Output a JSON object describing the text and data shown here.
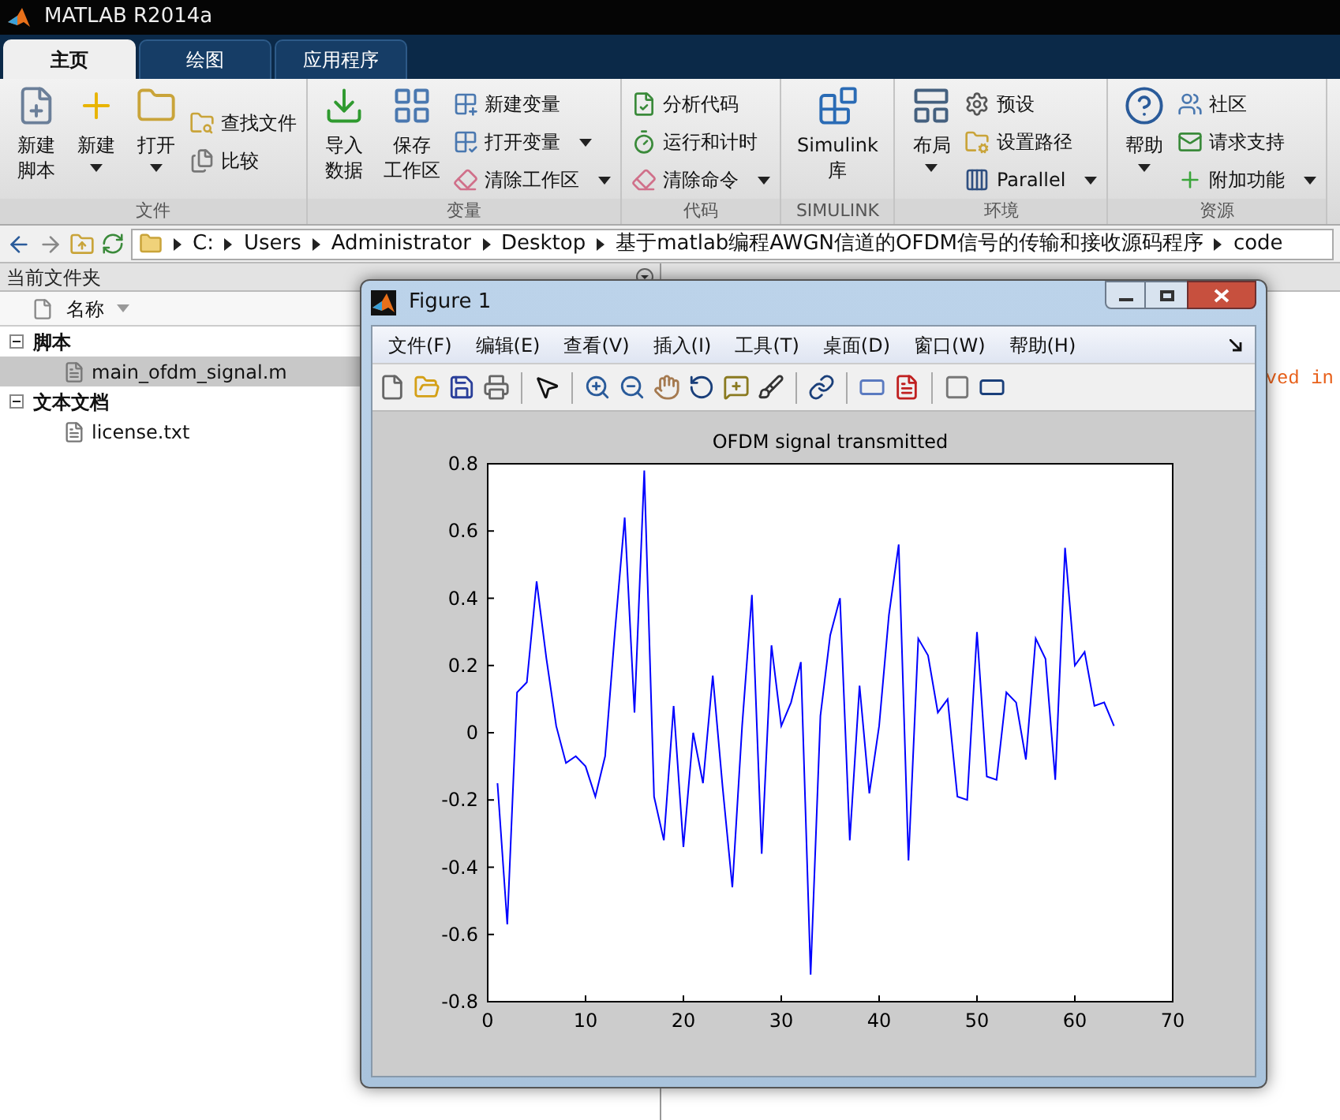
{
  "title_bar": {
    "title": "MATLAB R2014a"
  },
  "tabs": [
    {
      "label": "主页",
      "selected": true
    },
    {
      "label": "绘图",
      "selected": false
    },
    {
      "label": "应用程序",
      "selected": false
    }
  ],
  "ribbon": {
    "groups": [
      {
        "label": "文件",
        "items": [
          {
            "kind": "large",
            "lines": [
              "新建",
              "脚本"
            ],
            "dropdown": false
          },
          {
            "kind": "large",
            "lines": [
              "新建"
            ],
            "dropdown": true
          },
          {
            "kind": "large",
            "lines": [
              "打开"
            ],
            "dropdown": true
          },
          {
            "kind": "small",
            "lines": [
              "查找文件"
            ],
            "dropdown": false
          },
          {
            "kind": "small",
            "lines": [
              "比较"
            ],
            "dropdown": false
          }
        ]
      },
      {
        "label": "变量",
        "items": [
          {
            "kind": "large",
            "lines": [
              "导入",
              "数据"
            ],
            "dropdown": false
          },
          {
            "kind": "large",
            "lines": [
              "保存",
              "工作区"
            ],
            "dropdown": false
          },
          {
            "kind": "small",
            "lines": [
              "新建变量"
            ],
            "dropdown": false
          },
          {
            "kind": "small",
            "lines": [
              "打开变量"
            ],
            "dropdown": true
          },
          {
            "kind": "small",
            "lines": [
              "清除工作区"
            ],
            "dropdown": true
          }
        ]
      },
      {
        "label": "代码",
        "items": [
          {
            "kind": "small",
            "lines": [
              "分析代码"
            ],
            "dropdown": false
          },
          {
            "kind": "small",
            "lines": [
              "运行和计时"
            ],
            "dropdown": false
          },
          {
            "kind": "small",
            "lines": [
              "清除命令"
            ],
            "dropdown": true
          }
        ]
      },
      {
        "label": "SIMULINK",
        "items": [
          {
            "kind": "large",
            "lines": [
              "Simulink",
              "库"
            ],
            "dropdown": false
          }
        ]
      },
      {
        "label": "环境",
        "items": [
          {
            "kind": "large",
            "lines": [
              "布局"
            ],
            "dropdown": true
          },
          {
            "kind": "small",
            "lines": [
              "预设"
            ],
            "dropdown": false
          },
          {
            "kind": "small",
            "lines": [
              "设置路径"
            ],
            "dropdown": false
          },
          {
            "kind": "small",
            "lines": [
              "Parallel"
            ],
            "dropdown": true
          }
        ]
      },
      {
        "label": "资源",
        "items": [
          {
            "kind": "large",
            "lines": [
              "帮助"
            ],
            "dropdown": true
          },
          {
            "kind": "small",
            "lines": [
              "社区"
            ],
            "dropdown": false
          },
          {
            "kind": "small",
            "lines": [
              "请求支持"
            ],
            "dropdown": false
          },
          {
            "kind": "small",
            "lines": [
              "附加功能"
            ],
            "dropdown": true
          }
        ]
      }
    ]
  },
  "address_bar": {
    "segments": [
      "C:",
      "Users",
      "Administrator",
      "Desktop",
      "基于matlab编程AWGN信道的OFDM信号的传输和接收源码程序",
      "code"
    ]
  },
  "current_folder": {
    "title": "当前文件夹",
    "column": "名称",
    "tree": [
      {
        "label": "脚本",
        "expanded": true,
        "children": [
          {
            "label": "main_ofdm_signal.m",
            "selected": true
          }
        ]
      },
      {
        "label": "文本文档",
        "expanded": true,
        "children": [
          {
            "label": "license.txt",
            "selected": false
          }
        ]
      }
    ]
  },
  "command_window": {
    "text": "ved in"
  },
  "figure": {
    "title": "Figure 1",
    "menu": [
      "文件(F)",
      "编辑(E)",
      "查看(V)",
      "插入(I)",
      "工具(T)",
      "桌面(D)",
      "窗口(W)",
      "帮助(H)"
    ],
    "chart_data": {
      "type": "line",
      "title": "OFDM signal transmitted",
      "x": [
        1,
        2,
        3,
        4,
        5,
        6,
        7,
        8,
        9,
        10,
        11,
        12,
        13,
        14,
        15,
        16,
        17,
        18,
        19,
        20,
        21,
        22,
        23,
        24,
        25,
        26,
        27,
        28,
        29,
        30,
        31,
        32,
        33,
        34,
        35,
        36,
        37,
        38,
        39,
        40,
        41,
        42,
        43,
        44,
        45,
        46,
        47,
        48,
        49,
        50,
        51,
        52,
        53,
        54,
        55,
        56,
        57,
        58,
        59,
        60,
        61,
        62,
        63,
        64
      ],
      "series": [
        {
          "color": "#0000ff",
          "values": [
            -0.15,
            -0.57,
            0.12,
            0.15,
            0.45,
            0.22,
            0.02,
            -0.09,
            -0.07,
            -0.1,
            -0.19,
            -0.07,
            0.3,
            0.64,
            0.06,
            0.78,
            -0.19,
            -0.32,
            0.08,
            -0.34,
            0.0,
            -0.15,
            0.17,
            -0.16,
            -0.46,
            0.02,
            0.41,
            -0.36,
            0.26,
            0.02,
            0.09,
            0.21,
            -0.72,
            0.05,
            0.29,
            0.4,
            -0.32,
            0.14,
            -0.18,
            0.02,
            0.35,
            0.56,
            -0.38,
            0.28,
            0.23,
            0.06,
            0.1,
            -0.19,
            -0.2,
            0.3,
            -0.13,
            -0.14,
            0.12,
            0.09,
            -0.08,
            0.28,
            0.22,
            -0.14,
            0.55,
            0.2,
            0.24,
            0.08,
            0.09,
            0.02
          ]
        }
      ],
      "xlim": [
        0,
        70
      ],
      "ylim": [
        -0.8,
        0.8
      ],
      "xticks": [
        0,
        10,
        20,
        30,
        40,
        50,
        60,
        70
      ],
      "yticks": [
        -0.8,
        -0.6,
        -0.4,
        -0.2,
        0,
        0.2,
        0.4,
        0.6,
        0.8
      ]
    }
  }
}
